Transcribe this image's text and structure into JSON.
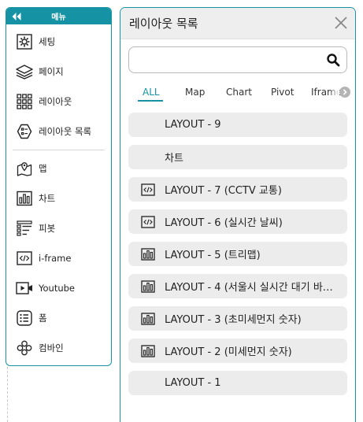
{
  "menu": {
    "header_label": "메뉴",
    "items_top": [
      {
        "label": "세팅",
        "icon": "gear-icon"
      },
      {
        "label": "페이지",
        "icon": "layers-icon"
      },
      {
        "label": "레이아웃",
        "icon": "grid-icon"
      },
      {
        "label": "레이아웃 목록",
        "icon": "hexagon-list-icon"
      }
    ],
    "items_bottom": [
      {
        "label": "맵",
        "icon": "map-pin-icon"
      },
      {
        "label": "차트",
        "icon": "bar-chart-icon"
      },
      {
        "label": "피봇",
        "icon": "pivot-icon"
      },
      {
        "label": "i-frame",
        "icon": "code-icon"
      },
      {
        "label": "Youtube",
        "icon": "video-icon"
      },
      {
        "label": "폼",
        "icon": "form-icon"
      },
      {
        "label": "컴바인",
        "icon": "combine-icon"
      }
    ]
  },
  "panel": {
    "title": "레이아웃 목록",
    "search": {
      "value": "",
      "placeholder": ""
    },
    "tabs": [
      "ALL",
      "Map",
      "Chart",
      "Pivot",
      "Iframe"
    ],
    "active_tab": "ALL",
    "layouts": [
      {
        "title": "LAYOUT - 9",
        "icon": "none"
      },
      {
        "title": "차트",
        "icon": "none"
      },
      {
        "title": "LAYOUT - 7 (CCTV 교통)",
        "icon": "code-icon"
      },
      {
        "title": "LAYOUT - 6 (실시간 날씨)",
        "icon": "code-icon"
      },
      {
        "title": "LAYOUT - 5 (트리맵)",
        "icon": "bar-chart-icon"
      },
      {
        "title": "LAYOUT - 4 (서울시 실시간 대기 바…",
        "icon": "bar-chart-icon"
      },
      {
        "title": "LAYOUT - 3 (초미세먼지 숫자)",
        "icon": "bar-chart-icon"
      },
      {
        "title": "LAYOUT - 2 (미세먼지 숫자)",
        "icon": "bar-chart-icon"
      },
      {
        "title": "LAYOUT - 1",
        "icon": "none"
      }
    ]
  },
  "colors": {
    "accent": "#1593a5",
    "row_bg": "#ececec",
    "header_bg": "#eeeeee"
  }
}
